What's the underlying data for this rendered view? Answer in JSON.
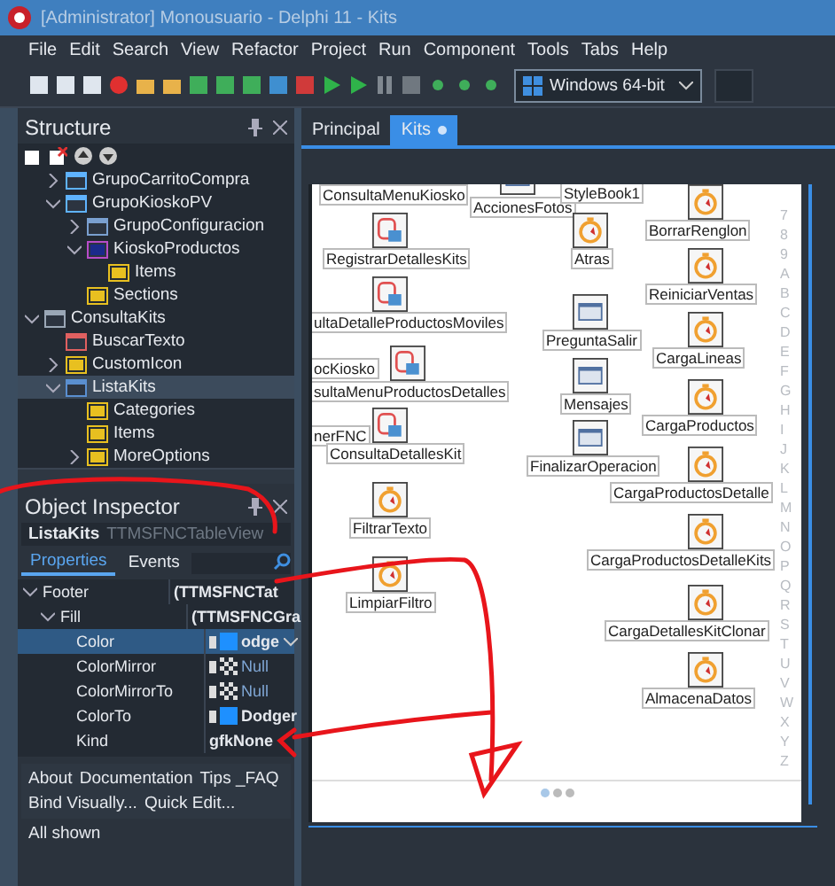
{
  "window": {
    "title": "[Administrator] Monousuario - Delphi 11 - Kits"
  },
  "menu": [
    "File",
    "Edit",
    "Search",
    "View",
    "Refactor",
    "Project",
    "Run",
    "Component",
    "Tools",
    "Tabs",
    "Help"
  ],
  "platform": {
    "value": "Windows 64-bit"
  },
  "structure": {
    "title": "Structure",
    "tree": [
      {
        "children": [
          {
            "label": "GrupoCarritoCompra",
            "kind": "panel",
            "expanded": false,
            "selected": false
          },
          {
            "label": "GrupoKioskoPV",
            "kind": "panel",
            "expanded": true,
            "selected": false,
            "children": [
              {
                "label": "GrupoConfiguracion",
                "kind": "layout",
                "expanded": false,
                "selected": false
              },
              {
                "label": "KioskoProductos",
                "kind": "grid",
                "expanded": true,
                "selected": false,
                "children": [
                  {
                    "label": "Items",
                    "kind": "collection",
                    "selected": false
                  }
                ]
              },
              {
                "label": "Sections",
                "kind": "collection",
                "selected": false
              }
            ]
          }
        ]
      },
      {
        "label": "ConsultaKits",
        "kind": "query",
        "expanded": true,
        "selected": false,
        "children": [
          {
            "label": "BuscarTexto",
            "kind": "edit",
            "selected": false
          },
          {
            "label": "CustomIcon",
            "kind": "collection",
            "expanded": false,
            "selected": false
          },
          {
            "label": "ListaKits",
            "kind": "list",
            "expanded": true,
            "selected": true,
            "children": [
              {
                "label": "Categories",
                "kind": "collection",
                "selected": false
              },
              {
                "label": "Items",
                "kind": "collection",
                "selected": false
              },
              {
                "label": "MoreOptions",
                "kind": "collection",
                "expanded": false,
                "selected": false
              }
            ]
          }
        ]
      }
    ]
  },
  "inspector": {
    "title": "Object Inspector",
    "object": "ListaKits",
    "class": "TTMSFNCTableView",
    "tabs": [
      {
        "label": "Properties",
        "selected": true
      },
      {
        "label": "Events",
        "selected": false
      }
    ],
    "properties": [
      {
        "name": "Footer",
        "value": "(TTMSFNCTat",
        "expanded": true,
        "selected": false,
        "children": [
          {
            "name": "Fill",
            "value": "(TTMSFNCGra",
            "expanded": true,
            "selected": false,
            "children": [
              {
                "name": "Color",
                "value": "odge",
                "kind": "color",
                "color": "#1e90ff",
                "selected": true
              },
              {
                "name": "ColorMirror",
                "value": "Null",
                "kind": "null",
                "selected": false
              },
              {
                "name": "ColorMirrorTo",
                "value": "Null",
                "kind": "null",
                "selected": false
              },
              {
                "name": "ColorTo",
                "value": "Dodger",
                "kind": "color",
                "color": "#1e90ff",
                "selected": false
              },
              {
                "name": "Kind",
                "value": "gfkNone",
                "kind": "text",
                "selected": false
              }
            ]
          }
        ]
      }
    ],
    "links": [
      [
        "About",
        "Documentation",
        "Tips _FAQ"
      ],
      [
        "Bind Visually...",
        "Quick Edit..."
      ]
    ],
    "status": "All shown"
  },
  "editor": {
    "tabs": [
      {
        "label": "Principal",
        "selected": false,
        "modified": false
      },
      {
        "label": "Kits",
        "selected": true,
        "modified": true
      }
    ],
    "components": [
      {
        "label": "ConsultaMenuKiosko",
        "kind": "none"
      },
      {
        "label": "AccionesFotos",
        "kind": "form"
      },
      {
        "label": "StyleBook1",
        "kind": "none"
      },
      {
        "label": "BorrarRenglon",
        "kind": "action"
      },
      {
        "label": "RegistrarDetallesKits",
        "kind": "dataset"
      },
      {
        "label": "Atras",
        "kind": "action"
      },
      {
        "label": "ReiniciarVentas",
        "kind": "action"
      },
      {
        "label": "ultaDetalleProductosMoviles",
        "kind": "dataset"
      },
      {
        "label": "PreguntaSalir",
        "kind": "form"
      },
      {
        "label": "CargaLineas",
        "kind": "action"
      },
      {
        "label": "ocKiosko",
        "kind": "none"
      },
      {
        "label": "sultaMenuProductosDetalles",
        "kind": "dataset"
      },
      {
        "label": "Mensajes",
        "kind": "form"
      },
      {
        "label": "CargaProductos",
        "kind": "action"
      },
      {
        "label": "nerFNC",
        "kind": "none"
      },
      {
        "label": "ConsultaDetallesKit",
        "kind": "dataset"
      },
      {
        "label": "FinalizarOperacion",
        "kind": "form"
      },
      {
        "label": "CargaProductosDetalle",
        "kind": "action"
      },
      {
        "label": "FiltrarTexto",
        "kind": "action"
      },
      {
        "label": "CargaProductosDetalleKits",
        "kind": "action"
      },
      {
        "label": "LimpiarFiltro",
        "kind": "action"
      },
      {
        "label": "CargaDetallesKitClonar",
        "kind": "action"
      },
      {
        "label": "AlmacenaDatos",
        "kind": "action"
      }
    ],
    "index": [
      "7",
      "8",
      "9",
      "A",
      "B",
      "C",
      "D",
      "E",
      "F",
      "G",
      "H",
      "I",
      "J",
      "K",
      "L",
      "M",
      "N",
      "O",
      "P",
      "Q",
      "R",
      "S",
      "T",
      "U",
      "V",
      "W",
      "X",
      "Y",
      "Z"
    ]
  },
  "markup": {
    "color": "#e8151b"
  }
}
